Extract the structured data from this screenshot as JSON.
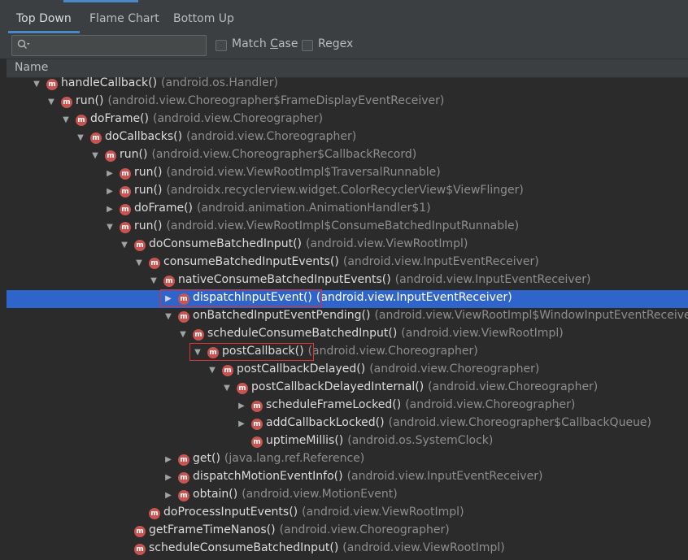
{
  "tabs": [
    {
      "label": "Top Down",
      "active": true
    },
    {
      "label": "Flame Chart",
      "active": false
    },
    {
      "label": "Bottom Up",
      "active": false
    }
  ],
  "search": {
    "value": "",
    "placeholder": ""
  },
  "filters": {
    "match_case": {
      "prefix": "Match ",
      "underlined": "C",
      "suffix": "ase",
      "checked": false
    },
    "regex": {
      "label": "Regex",
      "checked": false
    }
  },
  "table": {
    "column_name": "Name"
  },
  "tree": [
    {
      "depth": 3,
      "state": "expanded",
      "method": "handleCallback()",
      "cls": "(android.os.Handler)"
    },
    {
      "depth": 4,
      "state": "expanded",
      "method": "run()",
      "cls": "(android.view.Choreographer$FrameDisplayEventReceiver)"
    },
    {
      "depth": 5,
      "state": "expanded",
      "method": "doFrame()",
      "cls": "(android.view.Choreographer)"
    },
    {
      "depth": 6,
      "state": "expanded",
      "method": "doCallbacks()",
      "cls": "(android.view.Choreographer)"
    },
    {
      "depth": 7,
      "state": "expanded",
      "method": "run()",
      "cls": "(android.view.Choreographer$CallbackRecord)"
    },
    {
      "depth": 8,
      "state": "collapsed",
      "method": "run()",
      "cls": "(android.view.ViewRootImpl$TraversalRunnable)"
    },
    {
      "depth": 8,
      "state": "collapsed",
      "method": "run()",
      "cls": "(androidx.recyclerview.widget.ColorRecyclerView$ViewFlinger)"
    },
    {
      "depth": 8,
      "state": "collapsed",
      "method": "doFrame()",
      "cls": "(android.animation.AnimationHandler$1)"
    },
    {
      "depth": 8,
      "state": "expanded",
      "method": "run()",
      "cls": "(android.view.ViewRootImpl$ConsumeBatchedInputRunnable)"
    },
    {
      "depth": 9,
      "state": "expanded",
      "method": "doConsumeBatchedInput()",
      "cls": "(android.view.ViewRootImpl)"
    },
    {
      "depth": 10,
      "state": "expanded",
      "method": "consumeBatchedInputEvents()",
      "cls": "(android.view.InputEventReceiver)"
    },
    {
      "depth": 11,
      "state": "expanded",
      "method": "nativeConsumeBatchedInputEvents()",
      "cls": "(android.view.InputEventReceiver)"
    },
    {
      "depth": 12,
      "state": "collapsed",
      "method": "dispatchInputEvent()",
      "cls": "(android.view.InputEventReceiver)",
      "selected": true,
      "highlight": true
    },
    {
      "depth": 12,
      "state": "expanded",
      "method": "onBatchedInputEventPending()",
      "cls": "(android.view.ViewRootImpl$WindowInputEventReceiver)"
    },
    {
      "depth": 13,
      "state": "expanded",
      "method": "scheduleConsumeBatchedInput()",
      "cls": "(android.view.ViewRootImpl)"
    },
    {
      "depth": 14,
      "state": "expanded",
      "method": "postCallback()",
      "cls": "(android.view.Choreographer)",
      "highlight": true
    },
    {
      "depth": 15,
      "state": "expanded",
      "method": "postCallbackDelayed()",
      "cls": "(android.view.Choreographer)"
    },
    {
      "depth": 16,
      "state": "expanded",
      "method": "postCallbackDelayedInternal()",
      "cls": "(android.view.Choreographer)"
    },
    {
      "depth": 17,
      "state": "collapsed",
      "method": "scheduleFrameLocked()",
      "cls": "(android.view.Choreographer)"
    },
    {
      "depth": 17,
      "state": "collapsed",
      "method": "addCallbackLocked()",
      "cls": "(android.view.Choreographer$CallbackQueue)"
    },
    {
      "depth": 17,
      "state": "leaf",
      "method": "uptimeMillis()",
      "cls": "(android.os.SystemClock)"
    },
    {
      "depth": 12,
      "state": "collapsed",
      "method": "get()",
      "cls": "(java.lang.ref.Reference)"
    },
    {
      "depth": 12,
      "state": "collapsed",
      "method": "dispatchMotionEventInfo()",
      "cls": "(android.view.InputEventReceiver)"
    },
    {
      "depth": 12,
      "state": "collapsed",
      "method": "obtain()",
      "cls": "(android.view.MotionEvent)"
    },
    {
      "depth": 10,
      "state": "leaf",
      "method": "doProcessInputEvents()",
      "cls": "(android.view.ViewRootImpl)"
    },
    {
      "depth": 9,
      "state": "leaf",
      "method": "getFrameTimeNanos()",
      "cls": "(android.view.Choreographer)"
    },
    {
      "depth": 9,
      "state": "leaf",
      "method": "scheduleConsumeBatchedInput()",
      "cls": "(android.view.ViewRootImpl)"
    }
  ],
  "icons": {
    "method_badge": "m",
    "expanded": "▼",
    "collapsed": "▶"
  },
  "colors": {
    "selection": "#2f65ca",
    "method_icon": "#c75450",
    "highlight_box": "#e03030",
    "active_tab": "#4a88c7"
  }
}
